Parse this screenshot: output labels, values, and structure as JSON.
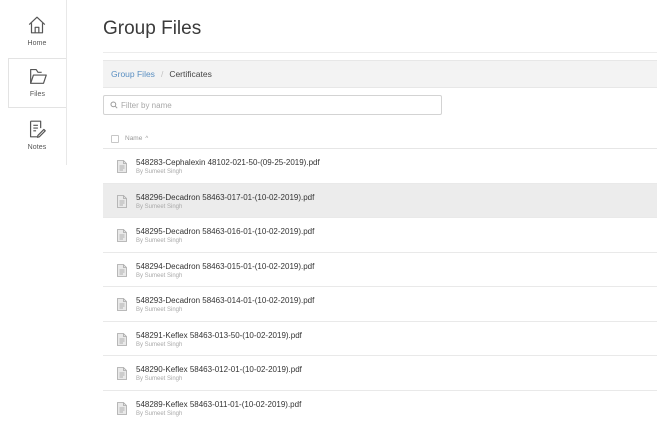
{
  "nav": {
    "items": [
      {
        "id": "home",
        "label": "Home",
        "icon": "home-icon"
      },
      {
        "id": "files",
        "label": "Files",
        "icon": "folder-icon",
        "active": true
      },
      {
        "id": "notes",
        "label": "Notes",
        "icon": "notes-icon"
      }
    ]
  },
  "page": {
    "title": "Group Files"
  },
  "breadcrumb": {
    "root": "Group Files",
    "separator": "/",
    "current": "Certificates"
  },
  "filter": {
    "placeholder": "Filter by name",
    "value": ""
  },
  "list": {
    "column_name": "Name",
    "sort_indicator": "^",
    "owner_prefix": "By",
    "files": [
      {
        "name": "548283-Cephalexin 48102-021-50-(09-25-2019).pdf",
        "owner": "By Sumeet Singh",
        "selected": false
      },
      {
        "name": "548296-Decadron 58463-017-01-(10-02-2019).pdf",
        "owner": "By Sumeet Singh",
        "selected": true
      },
      {
        "name": "548295-Decadron 58463-016-01-(10-02-2019).pdf",
        "owner": "By Sumeet Singh",
        "selected": false
      },
      {
        "name": "548294-Decadron 58463-015-01-(10-02-2019).pdf",
        "owner": "By Sumeet Singh",
        "selected": false
      },
      {
        "name": "548293-Decadron 58463-014-01-(10-02-2019).pdf",
        "owner": "By Sumeet Singh",
        "selected": false
      },
      {
        "name": "548291-Keflex 58463-013-50-(10-02-2019).pdf",
        "owner": "By Sumeet Singh",
        "selected": false
      },
      {
        "name": "548290-Keflex 58463-012-01-(10-02-2019).pdf",
        "owner": "By Sumeet Singh",
        "selected": false
      },
      {
        "name": "548289-Keflex 58463-011-01-(10-02-2019).pdf",
        "owner": "By Sumeet Singh",
        "selected": false
      }
    ]
  },
  "colors": {
    "link": "#5a8fc2",
    "selected_row": "#ececec",
    "breadcrumb_bg": "#f3f3f3"
  }
}
